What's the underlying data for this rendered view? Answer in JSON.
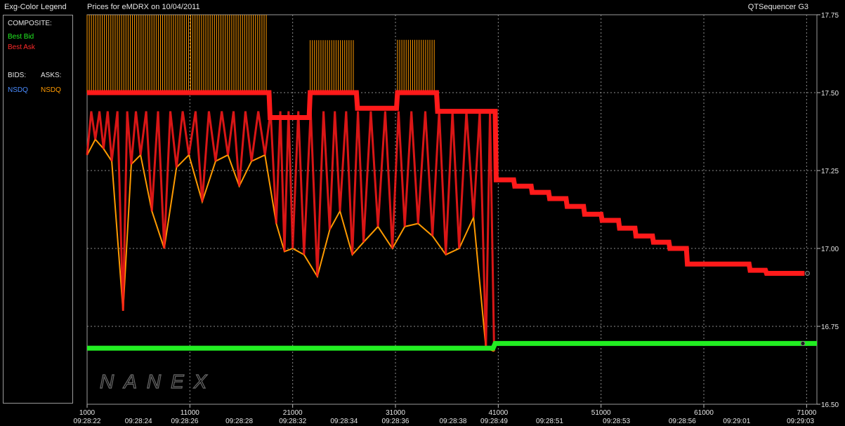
{
  "header": {
    "legend_title": "Exg-Color Legend",
    "chart_title": "Prices for  eMDRX  on  10/04/2011",
    "app_name": "QTSequencer G3"
  },
  "legend": {
    "composite_label": "COMPOSITE:",
    "best_bid": "Best Bid",
    "best_ask": "Best Ask",
    "bids_label": "BIDS:",
    "asks_label": "ASKS:",
    "bid_exchange": "NSDQ",
    "ask_exchange": "NSDQ"
  },
  "watermark": "NANEX",
  "colors": {
    "background": "#000000",
    "grid": "#8c8c8c",
    "best_bid": "#22ee22",
    "best_ask": "#ff1a1a",
    "nsdq_ask": "#ff9a00",
    "nsdq_bid": "#4a8cff",
    "text": "#e6e6e6"
  },
  "chart_data": {
    "type": "line",
    "title": "Prices for  eMDRX  on  10/04/2011",
    "xlabel": "",
    "ylabel": "",
    "xlim": [
      1000,
      72000
    ],
    "ylim": [
      16.5,
      17.75
    ],
    "y_ticks": [
      "17.75",
      "17.50",
      "17.25",
      "17.00",
      "16.75",
      "16.50"
    ],
    "y_tick_values": [
      17.75,
      17.5,
      17.25,
      17.0,
      16.75,
      16.5
    ],
    "x_ticks": [
      "1000",
      "11000",
      "21000",
      "31000",
      "41000",
      "51000",
      "61000",
      "71000"
    ],
    "x_tick_values": [
      1000,
      11000,
      21000,
      31000,
      41000,
      51000,
      61000,
      71000
    ],
    "time_labels": [
      {
        "x": 1000,
        "label": "09:28:22"
      },
      {
        "x": 6000,
        "label": "09:28:24"
      },
      {
        "x": 10500,
        "label": "09:28:26"
      },
      {
        "x": 15800,
        "label": "09:28:28"
      },
      {
        "x": 21000,
        "label": "09:28:32"
      },
      {
        "x": 26000,
        "label": "09:28:34"
      },
      {
        "x": 31000,
        "label": "09:28:36"
      },
      {
        "x": 36600,
        "label": "09:28:38"
      },
      {
        "x": 40600,
        "label": "09:28:49"
      },
      {
        "x": 46000,
        "label": "09:28:51"
      },
      {
        "x": 52500,
        "label": "09:28:53"
      },
      {
        "x": 58900,
        "label": "09:28:56"
      },
      {
        "x": 64200,
        "label": "09:29:01"
      },
      {
        "x": 70400,
        "label": "09:29:03"
      }
    ],
    "grid": true,
    "legend_position": "left panel",
    "series": [
      {
        "name": "Best Bid",
        "x": [
          1000,
          40500,
          40700,
          72000
        ],
        "y": [
          16.68,
          16.68,
          16.695,
          16.695
        ]
      },
      {
        "name": "Best Ask",
        "x": [
          1000,
          18700,
          18800,
          22600,
          22700,
          27200,
          27300,
          31100,
          31200,
          35000,
          35100,
          40700,
          40800,
          42500,
          42600,
          44200,
          44300,
          45900,
          46000,
          47600,
          47700,
          49300,
          49400,
          51000,
          51100,
          52700,
          52800,
          54300,
          54400,
          56000,
          56100,
          57600,
          57700,
          59300,
          59400,
          61000,
          61100,
          65400,
          65500,
          67000,
          67100,
          70800
        ],
        "y": [
          17.5,
          17.5,
          17.42,
          17.42,
          17.5,
          17.5,
          17.45,
          17.45,
          17.5,
          17.5,
          17.44,
          17.44,
          17.22,
          17.22,
          17.2,
          17.2,
          17.18,
          17.18,
          17.16,
          17.16,
          17.135,
          17.135,
          17.11,
          17.11,
          17.09,
          17.09,
          17.065,
          17.065,
          17.04,
          17.04,
          17.02,
          17.02,
          17.0,
          17.0,
          16.95,
          16.95,
          16.95,
          16.95,
          16.93,
          16.93,
          16.92,
          16.92
        ]
      },
      {
        "name": "NSDQ",
        "x": [
          1000,
          1800,
          2600,
          3400,
          4500,
          5300,
          6200,
          7300,
          8500,
          9700,
          10900,
          12200,
          13500,
          14700,
          15800,
          17000,
          18300,
          19400,
          20200,
          21000,
          22100,
          23400,
          24600,
          25600,
          26800,
          27900,
          29300,
          30700,
          31900,
          33200,
          34600,
          35900,
          37200,
          38600,
          39800,
          40600
        ],
        "y": [
          17.3,
          17.35,
          17.32,
          17.28,
          16.8,
          17.27,
          17.3,
          17.12,
          17.0,
          17.26,
          17.3,
          17.15,
          17.28,
          17.3,
          17.2,
          17.28,
          17.3,
          17.08,
          16.99,
          17.0,
          16.98,
          16.91,
          17.06,
          17.12,
          16.98,
          17.02,
          17.07,
          17.0,
          17.07,
          17.08,
          17.04,
          16.98,
          17.0,
          17.1,
          16.68,
          16.67
        ]
      }
    ],
    "nsdq_ask_peaks": [
      {
        "x_start": 1000,
        "x_end": 18600,
        "y": 17.75
      },
      {
        "x_start": 22700,
        "x_end": 27100,
        "y": 17.67
      },
      {
        "x_start": 31200,
        "x_end": 34900,
        "y": 17.67
      }
    ]
  }
}
